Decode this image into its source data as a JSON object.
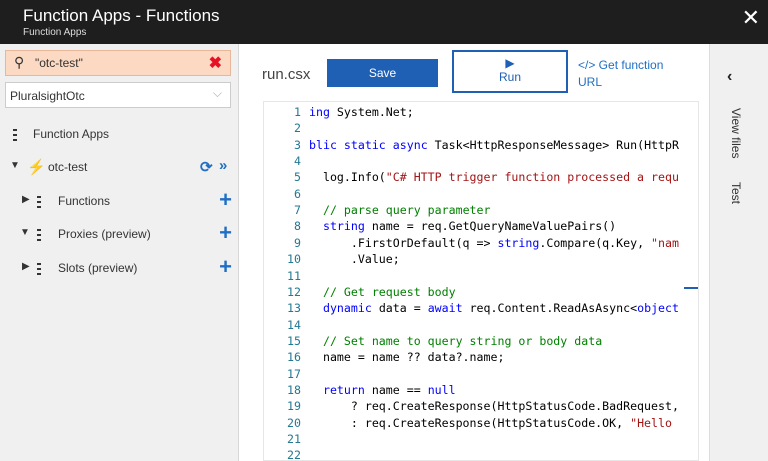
{
  "titlebar": {
    "title": "Function Apps - Functions",
    "subtitle": "Function Apps",
    "close_glyph": "✕"
  },
  "sidebar": {
    "search": {
      "value": "\"otc-test\"",
      "icon": "search-icon",
      "clear_icon": "close-icon"
    },
    "subscription": {
      "value": "PluralsightOtc"
    },
    "root_label": "Function Apps",
    "app": {
      "name": "otc-test",
      "icon": "function-bolt-icon"
    },
    "items": [
      {
        "label": "Functions",
        "expanded": false
      },
      {
        "label": "Proxies (preview)",
        "expanded": true
      },
      {
        "label": "Slots (preview)",
        "expanded": false
      }
    ]
  },
  "main": {
    "file_name": "run.csx",
    "save_label": "Save",
    "run_label": "Run",
    "get_url_line1": "</> Get function",
    "get_url_line2": "URL"
  },
  "editor": {
    "lines": [
      {
        "n": "1",
        "text": "ing System.Net;"
      },
      {
        "n": "2",
        "text": ""
      },
      {
        "n": "3",
        "text": "blic static async Task<HttpResponseMessage> Run(HttpR"
      },
      {
        "n": "4",
        "text": ""
      },
      {
        "n": "5",
        "text": "  log.Info(\"C# HTTP trigger function processed a requ"
      },
      {
        "n": "6",
        "text": ""
      },
      {
        "n": "7",
        "text": "  // parse query parameter"
      },
      {
        "n": "8",
        "text": "  string name = req.GetQueryNameValuePairs()"
      },
      {
        "n": "9",
        "text": "      .FirstOrDefault(q => string.Compare(q.Key, \"nam"
      },
      {
        "n": "10",
        "text": "      .Value;"
      },
      {
        "n": "11",
        "text": ""
      },
      {
        "n": "12",
        "text": "  // Get request body"
      },
      {
        "n": "13",
        "text": "  dynamic data = await req.Content.ReadAsAsync<object"
      },
      {
        "n": "14",
        "text": ""
      },
      {
        "n": "15",
        "text": "  // Set name to query string or body data"
      },
      {
        "n": "16",
        "text": "  name = name ?? data?.name;"
      },
      {
        "n": "17",
        "text": ""
      },
      {
        "n": "18",
        "text": "  return name == null"
      },
      {
        "n": "19",
        "text": "      ? req.CreateResponse(HttpStatusCode.BadRequest,"
      },
      {
        "n": "20",
        "text": "      : req.CreateResponse(HttpStatusCode.OK, \"Hello "
      },
      {
        "n": "21",
        "text": ""
      },
      {
        "n": "22",
        "text": ""
      }
    ]
  },
  "right_panel": {
    "view_files": "View files",
    "test": "Test"
  },
  "colors": {
    "accent": "#1f5fb4",
    "search_bg": "#fbd9c2",
    "titlebar": "#1e1e1e"
  }
}
